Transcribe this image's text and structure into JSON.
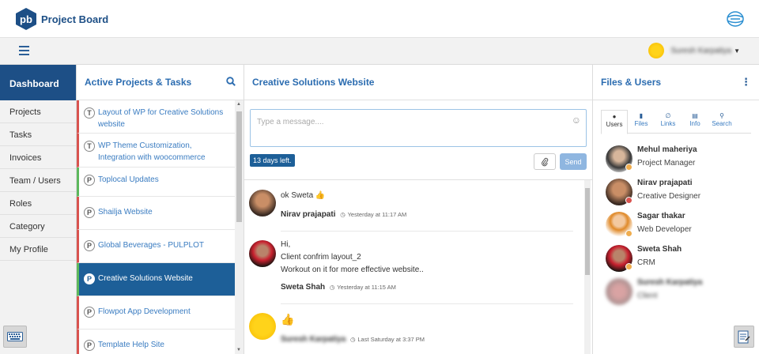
{
  "app": {
    "logo_mark": "pb",
    "title": "Project Board",
    "user_name": "Suresh Karpatiya"
  },
  "nav": {
    "active": "Dashboard",
    "items": [
      "Projects",
      "Tasks",
      "Invoices",
      "Team / Users",
      "Roles",
      "Category",
      "My Profile"
    ]
  },
  "projects": {
    "title": "Active Projects & Tasks",
    "items": [
      {
        "badge": "T",
        "label": "Layout of WP for Creative Solutions website",
        "color": "red"
      },
      {
        "badge": "T",
        "label": "WP Theme Customization, Integration with woocommerce",
        "color": "red"
      },
      {
        "badge": "P",
        "label": "Toplocal Updates",
        "color": "green"
      },
      {
        "badge": "P",
        "label": "Shailja Website",
        "color": "red"
      },
      {
        "badge": "P",
        "label": "Global Beverages - PULPLOT",
        "color": "red"
      },
      {
        "badge": "P",
        "label": "Creative Solutions Website",
        "color": "green",
        "active": true
      },
      {
        "badge": "P",
        "label": "Flowpot App Development",
        "color": "red"
      },
      {
        "badge": "P",
        "label": "Template Help Site",
        "color": "red"
      }
    ]
  },
  "chat": {
    "title": "Creative Solutions Website",
    "placeholder": "Type a message....",
    "days_left": "13 days left.",
    "send_label": "Send",
    "messages": [
      {
        "lines": [
          "ok Sweta 👍"
        ],
        "author": "Nirav prajapati",
        "time": "Yesterday at 11:17 AM"
      },
      {
        "lines": [
          "Hi,",
          "Client confrim layout_2",
          "Workout on it for more effective website.."
        ],
        "author": "Sweta Shah",
        "time": "Yesterday at 11:15 AM"
      },
      {
        "lines": [
          "👍"
        ],
        "author": "Suresh Karpatiya",
        "time": "Last Saturday at 3:37 PM"
      }
    ]
  },
  "files": {
    "title": "Files & Users",
    "tabs": [
      "Users",
      "Files",
      "Links",
      "Info",
      "Search"
    ],
    "users": [
      {
        "name": "Mehul maheriya",
        "role": "Project Manager",
        "status": "#f0ad4e"
      },
      {
        "name": "Nirav prajapati",
        "role": "Creative Designer",
        "status": "#d9534f"
      },
      {
        "name": "Sagar thakar",
        "role": "Web Developer",
        "status": "#f0ad4e"
      },
      {
        "name": "Sweta Shah",
        "role": "CRM",
        "status": "#f0ad4e"
      },
      {
        "name": "Suresh Karpatiya",
        "role": "Client",
        "status": "#cccccc"
      }
    ]
  },
  "colors": {
    "brand": "#1d4f86",
    "link": "#3a7cc1",
    "send": "#8fb6e0"
  }
}
